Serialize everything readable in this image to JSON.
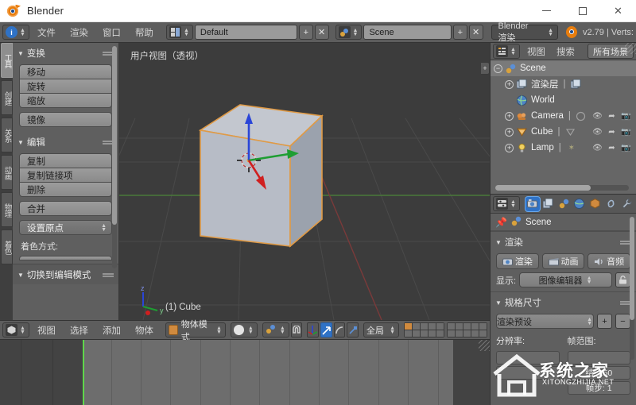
{
  "window": {
    "title": "Blender",
    "minimize_label": "—",
    "maximize_label": "□",
    "close_label": "✕"
  },
  "topbar": {
    "editor_icon": "info-editor-icon",
    "menus": [
      "文件",
      "渲染",
      "窗口",
      "帮助"
    ],
    "layout_icon": "screen-layout-icon",
    "layout_value": "Default",
    "layout_add_label": "+",
    "layout_delete_label": "✕",
    "scene_icon": "scene-icon",
    "scene_value": "Scene",
    "scene_add_label": "+",
    "scene_delete_label": "✕",
    "engine_value": "Blender 渲染",
    "status_text": "v2.79 | Verts:"
  },
  "toolshelf": {
    "tabs": [
      {
        "label": "工具",
        "active": true
      },
      {
        "label": "创建",
        "active": false
      },
      {
        "label": "关系",
        "active": false
      },
      {
        "label": "动画",
        "active": false
      },
      {
        "label": "物理",
        "active": false
      },
      {
        "label": "着色",
        "active": false
      }
    ],
    "sections": [
      {
        "title": "变换",
        "buttons": [
          "移动",
          "旋转",
          "缩放",
          "镜像"
        ]
      },
      {
        "title": "编辑",
        "buttons": [
          "复制",
          "复制链接项",
          "删除",
          "合并"
        ]
      }
    ],
    "origin_dropdown": "设置原点",
    "shading_label": "着色方式:",
    "collapsed_panel": "切换到编辑模式"
  },
  "viewport": {
    "view_label": "用户视图（透视）",
    "object_label": "(1) Cube",
    "axis_z": "z",
    "axis_y": "y",
    "axis_x": "x",
    "expand_label": "+",
    "background_color": "#3c3c3c",
    "selection_color": "#e09a45"
  },
  "viewport_footer": {
    "editor_icon": "3d-view-editor-icon",
    "menus": [
      "视图",
      "选择",
      "添加",
      "物体"
    ],
    "mode_value": "物体模式",
    "viewport_shading": "solid-shading-icon",
    "pivot_icon": "pivot-median-icon",
    "snap_icon": "magnet-icon",
    "manipulator_translate": "translate-manipulator-icon",
    "manipulator_rotate": "rotate-manipulator-icon",
    "manipulator_scale": "scale-manipulator-icon",
    "orientation_value": "全局"
  },
  "timeline": {
    "current_frame": 1,
    "playhead_color": "#5ed64a"
  },
  "outliner": {
    "editor_icon": "outliner-editor-icon",
    "menus": [
      "视图",
      "搜索"
    ],
    "display_mode": "所有场景",
    "rows": [
      {
        "label": "Scene",
        "icon": "scene-icon",
        "indent": 0,
        "selected": true,
        "expand": "−",
        "restrict": false
      },
      {
        "label": "渲染层",
        "icon": "render-layer-icon",
        "indent": 1,
        "selected": false,
        "expand": "+",
        "restrict": false
      },
      {
        "label": "World",
        "icon": "world-icon",
        "indent": 2,
        "selected": false,
        "expand": "",
        "restrict": false
      },
      {
        "label": "Camera",
        "icon": "camera-data-icon",
        "indent": 1,
        "selected": false,
        "expand": "+",
        "restrict": true
      },
      {
        "label": "Cube",
        "icon": "mesh-data-icon",
        "indent": 1,
        "selected": false,
        "expand": "+",
        "restrict": true
      },
      {
        "label": "Lamp",
        "icon": "lamp-data-icon",
        "indent": 1,
        "selected": false,
        "expand": "+",
        "restrict": true
      }
    ]
  },
  "properties": {
    "editor_icon": "properties-editor-icon",
    "tabs": [
      {
        "name": "render-tab",
        "glyph": "📷",
        "active": true
      },
      {
        "name": "render-layers-tab",
        "glyph": "◱",
        "active": false
      },
      {
        "name": "scene-tab",
        "glyph": "◑",
        "active": false
      },
      {
        "name": "world-tab",
        "glyph": "●",
        "active": false
      },
      {
        "name": "object-tab",
        "glyph": "■",
        "active": false
      },
      {
        "name": "constraints-tab",
        "glyph": "⛓",
        "active": false
      },
      {
        "name": "modifiers-tab",
        "glyph": "🔧",
        "active": false
      }
    ],
    "context_name": "Scene",
    "render_section_title": "渲染",
    "render_button": "渲染",
    "animation_button": "动画",
    "audio_button": "音频",
    "display_label": "显示:",
    "display_value": "图像编辑器",
    "dimensions_section_title": "规格尺寸",
    "preset_value": "渲染预设",
    "preset_add": "+",
    "preset_remove": "−",
    "resolution_label": "分辨率:",
    "frame_range_label": "帧范围:",
    "frame_end": "结: 250",
    "frame_step": "帧步: 1"
  },
  "watermark": {
    "text": "系统之家",
    "subtext": "XITONGZHIJIA.NET"
  }
}
